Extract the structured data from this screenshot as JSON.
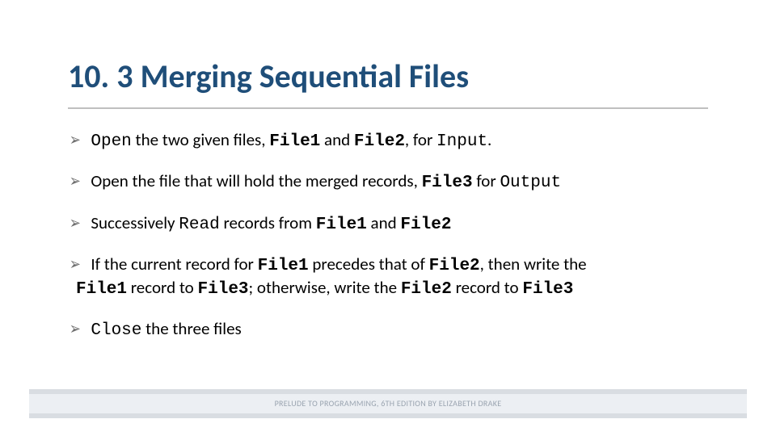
{
  "title": "10. 3 Merging Sequential Files",
  "bullets": {
    "b1": {
      "open": "Open",
      "rest1": " the two given files, ",
      "file1": "File1",
      "rest2": "  and ",
      "file2": "File2",
      "rest3": ", for ",
      "input": "Input",
      "rest4": "."
    },
    "b2": {
      "rest1": "Open the file that will hold the merged records, ",
      "file3": "File3",
      "rest2": " for ",
      "output": "Output"
    },
    "b3": {
      "rest1": "Successively ",
      "read": "Read",
      "rest2": " records from ",
      "file1": "File1",
      "rest3": " and ",
      "file2": "File2"
    },
    "b4": {
      "rest1": "If the current record for ",
      "file1": "File1",
      "rest2": " precedes that of ",
      "file2": "File2",
      "rest3": ", then write the",
      "line2a": "File1",
      "rest4": " record to ",
      "file3a": "File3",
      "rest5": "; otherwise, write the ",
      "file2b": "File2",
      "rest6": " record to ",
      "file3b": "File3"
    },
    "b5": {
      "close": "Close",
      "rest1": " the three files"
    }
  },
  "footer": "PRELUDE TO PROGRAMMING, 6TH EDITION BY ELIZABETH DRAKE",
  "glyph": "➢"
}
